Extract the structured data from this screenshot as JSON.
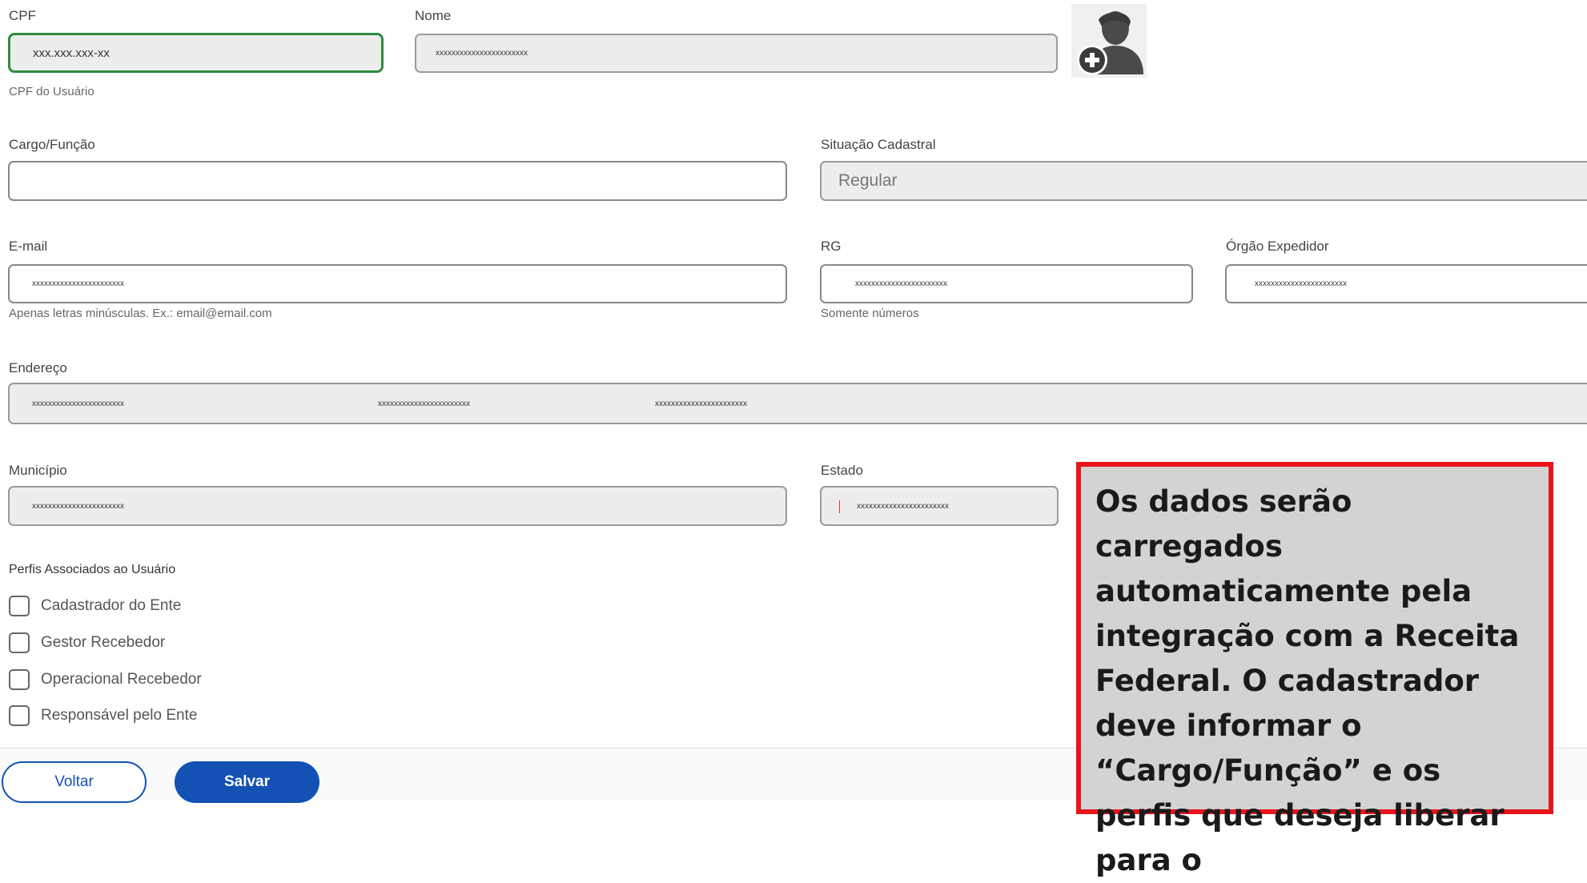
{
  "form": {
    "cpf": {
      "label": "CPF",
      "value": "xxx.xxx.xxx-xx",
      "hint": "CPF do Usuário"
    },
    "nome": {
      "label": "Nome",
      "value": "xxxxxxxxxxxxxxxxxxxxxxx"
    },
    "cargo": {
      "label": "Cargo/Função",
      "value": ""
    },
    "situacao": {
      "label": "Situação Cadastral",
      "value": "Regular"
    },
    "email": {
      "label": "E-mail",
      "value": "xxxxxxxxxxxxxxxxxxxxxxx",
      "hint": "Apenas letras minúsculas. Ex.: email@email.com"
    },
    "rg": {
      "label": "RG",
      "value": "xxxxxxxxxxxxxxxxxxxxxxx",
      "hint": "Somente números"
    },
    "orgao": {
      "label": "Órgão Expedidor",
      "value": "xxxxxxxxxxxxxxxxxxxxxxx"
    },
    "endereco": {
      "label": "Endereço",
      "values": [
        "xxxxxxxxxxxxxxxxxxxxxxx",
        "xxxxxxxxxxxxxxxxxxxxxxx",
        "xxxxxxxxxxxxxxxxxxxxxxx"
      ]
    },
    "municipio": {
      "label": "Município",
      "value": "xxxxxxxxxxxxxxxxxxxxxxx"
    },
    "estado": {
      "label": "Estado",
      "value": "xxxxxxxxxxxxxxxxxxxxxxx"
    }
  },
  "perfis": {
    "title": "Perfis Associados ao Usuário",
    "items": [
      "Cadastrador do Ente",
      "Gestor Recebedor",
      "Operacional Recebedor",
      "Responsável pelo Ente"
    ]
  },
  "buttons": {
    "voltar": "Voltar",
    "salvar": "Salvar"
  },
  "callout": {
    "text": "Os dados serão carregados automaticamente pela integração com a Receita Federal. O cadastrador deve informar o “Cargo/Função” e os perfis que deseja liberar para o"
  },
  "colors": {
    "primary": "#1351b4",
    "focus": "#2e8b3e",
    "callout_border": "#e8141b",
    "callout_bg": "#d3d3d3"
  }
}
